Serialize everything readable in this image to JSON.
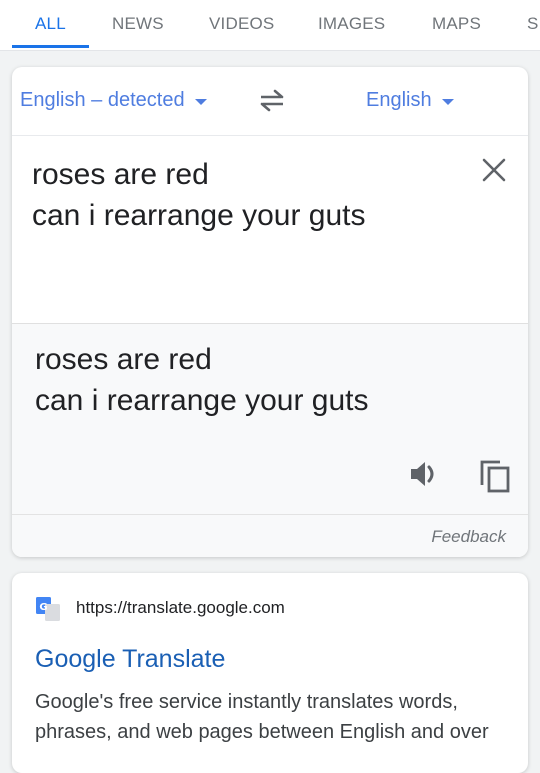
{
  "tabs": [
    {
      "label": "ALL",
      "active": true
    },
    {
      "label": "NEWS"
    },
    {
      "label": "VIDEOS"
    },
    {
      "label": "IMAGES"
    },
    {
      "label": "MAPS"
    },
    {
      "label": "S"
    }
  ],
  "translate": {
    "source_language": "English – detected",
    "target_language": "English",
    "source_text": "roses are red\ncan i rearrange your guts",
    "target_text": "roses are red\ncan i rearrange your guts",
    "feedback_label": "Feedback"
  },
  "icons": {
    "swap": "swap-arrows-icon",
    "clear": "close-icon",
    "speaker": "speaker-icon",
    "copy": "copy-icon",
    "favicon": "google-translate-favicon"
  },
  "colors": {
    "accent": "#1a73e8",
    "language_link": "#4f7de0",
    "result_title": "#1a5fb4"
  },
  "result": {
    "url": "https://translate.google.com",
    "title": "Google Translate",
    "snippet": "Google's free service instantly translates words, phrases, and web pages between English and over"
  }
}
